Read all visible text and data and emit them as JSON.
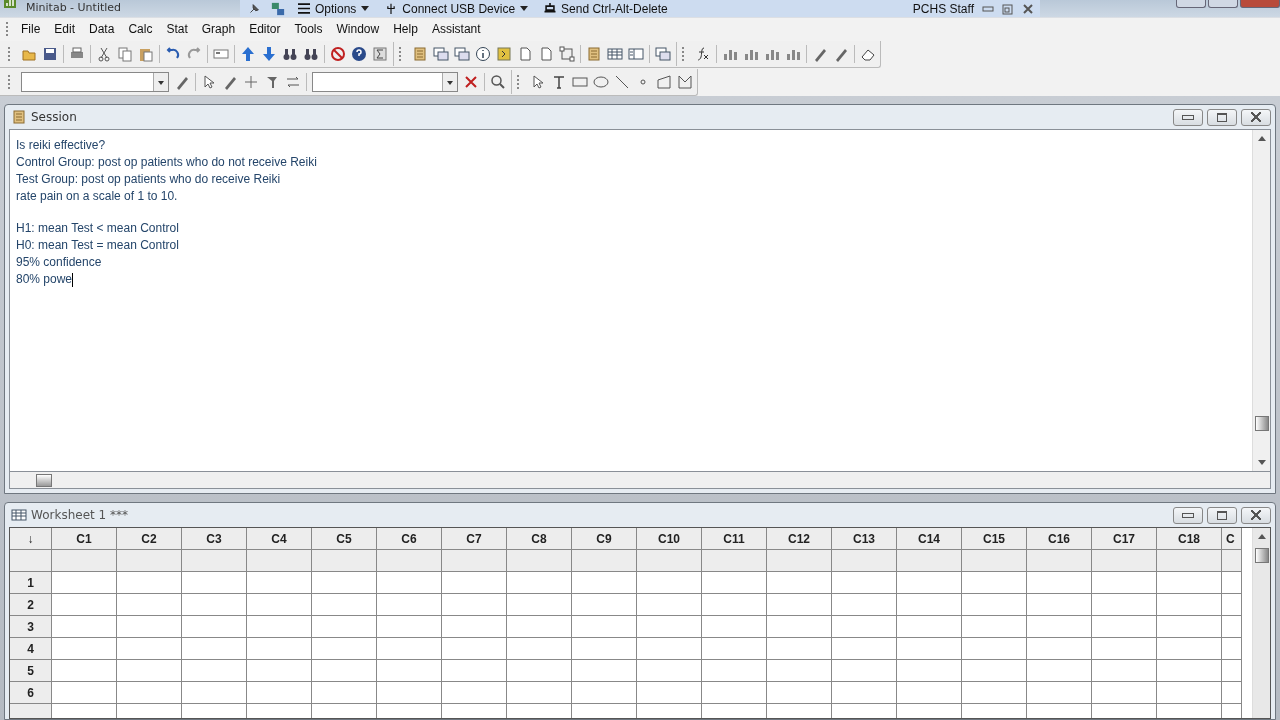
{
  "window": {
    "title": "Minitab - Untitled"
  },
  "remote_bar": {
    "items": [
      "Options",
      "Connect USB Device",
      "Send Ctrl-Alt-Delete"
    ],
    "user": "PCHS Staff"
  },
  "menu": [
    "File",
    "Edit",
    "Data",
    "Calc",
    "Stat",
    "Graph",
    "Editor",
    "Tools",
    "Window",
    "Help",
    "Assistant"
  ],
  "session": {
    "title": "Session",
    "paragraphs": [
      [
        "Is reiki effective?",
        "Control Group: post op patients who do not receive Reiki",
        "Test Group: post op patients who do receive Reiki",
        "rate pain on a scale of 1 to 10."
      ],
      [
        "H1: mean Test < mean Control",
        "H0: mean Test = mean Control",
        "95% confidence",
        "80% powe"
      ]
    ]
  },
  "worksheet": {
    "title": "Worksheet 1 ***",
    "corner": "↓",
    "columns": [
      "C1",
      "C2",
      "C3",
      "C4",
      "C5",
      "C6",
      "C7",
      "C8",
      "C9",
      "C10",
      "C11",
      "C12",
      "C13",
      "C14",
      "C15",
      "C16",
      "C17",
      "C18",
      "C"
    ],
    "rows": [
      "1",
      "2",
      "3",
      "4",
      "5",
      "6"
    ]
  }
}
